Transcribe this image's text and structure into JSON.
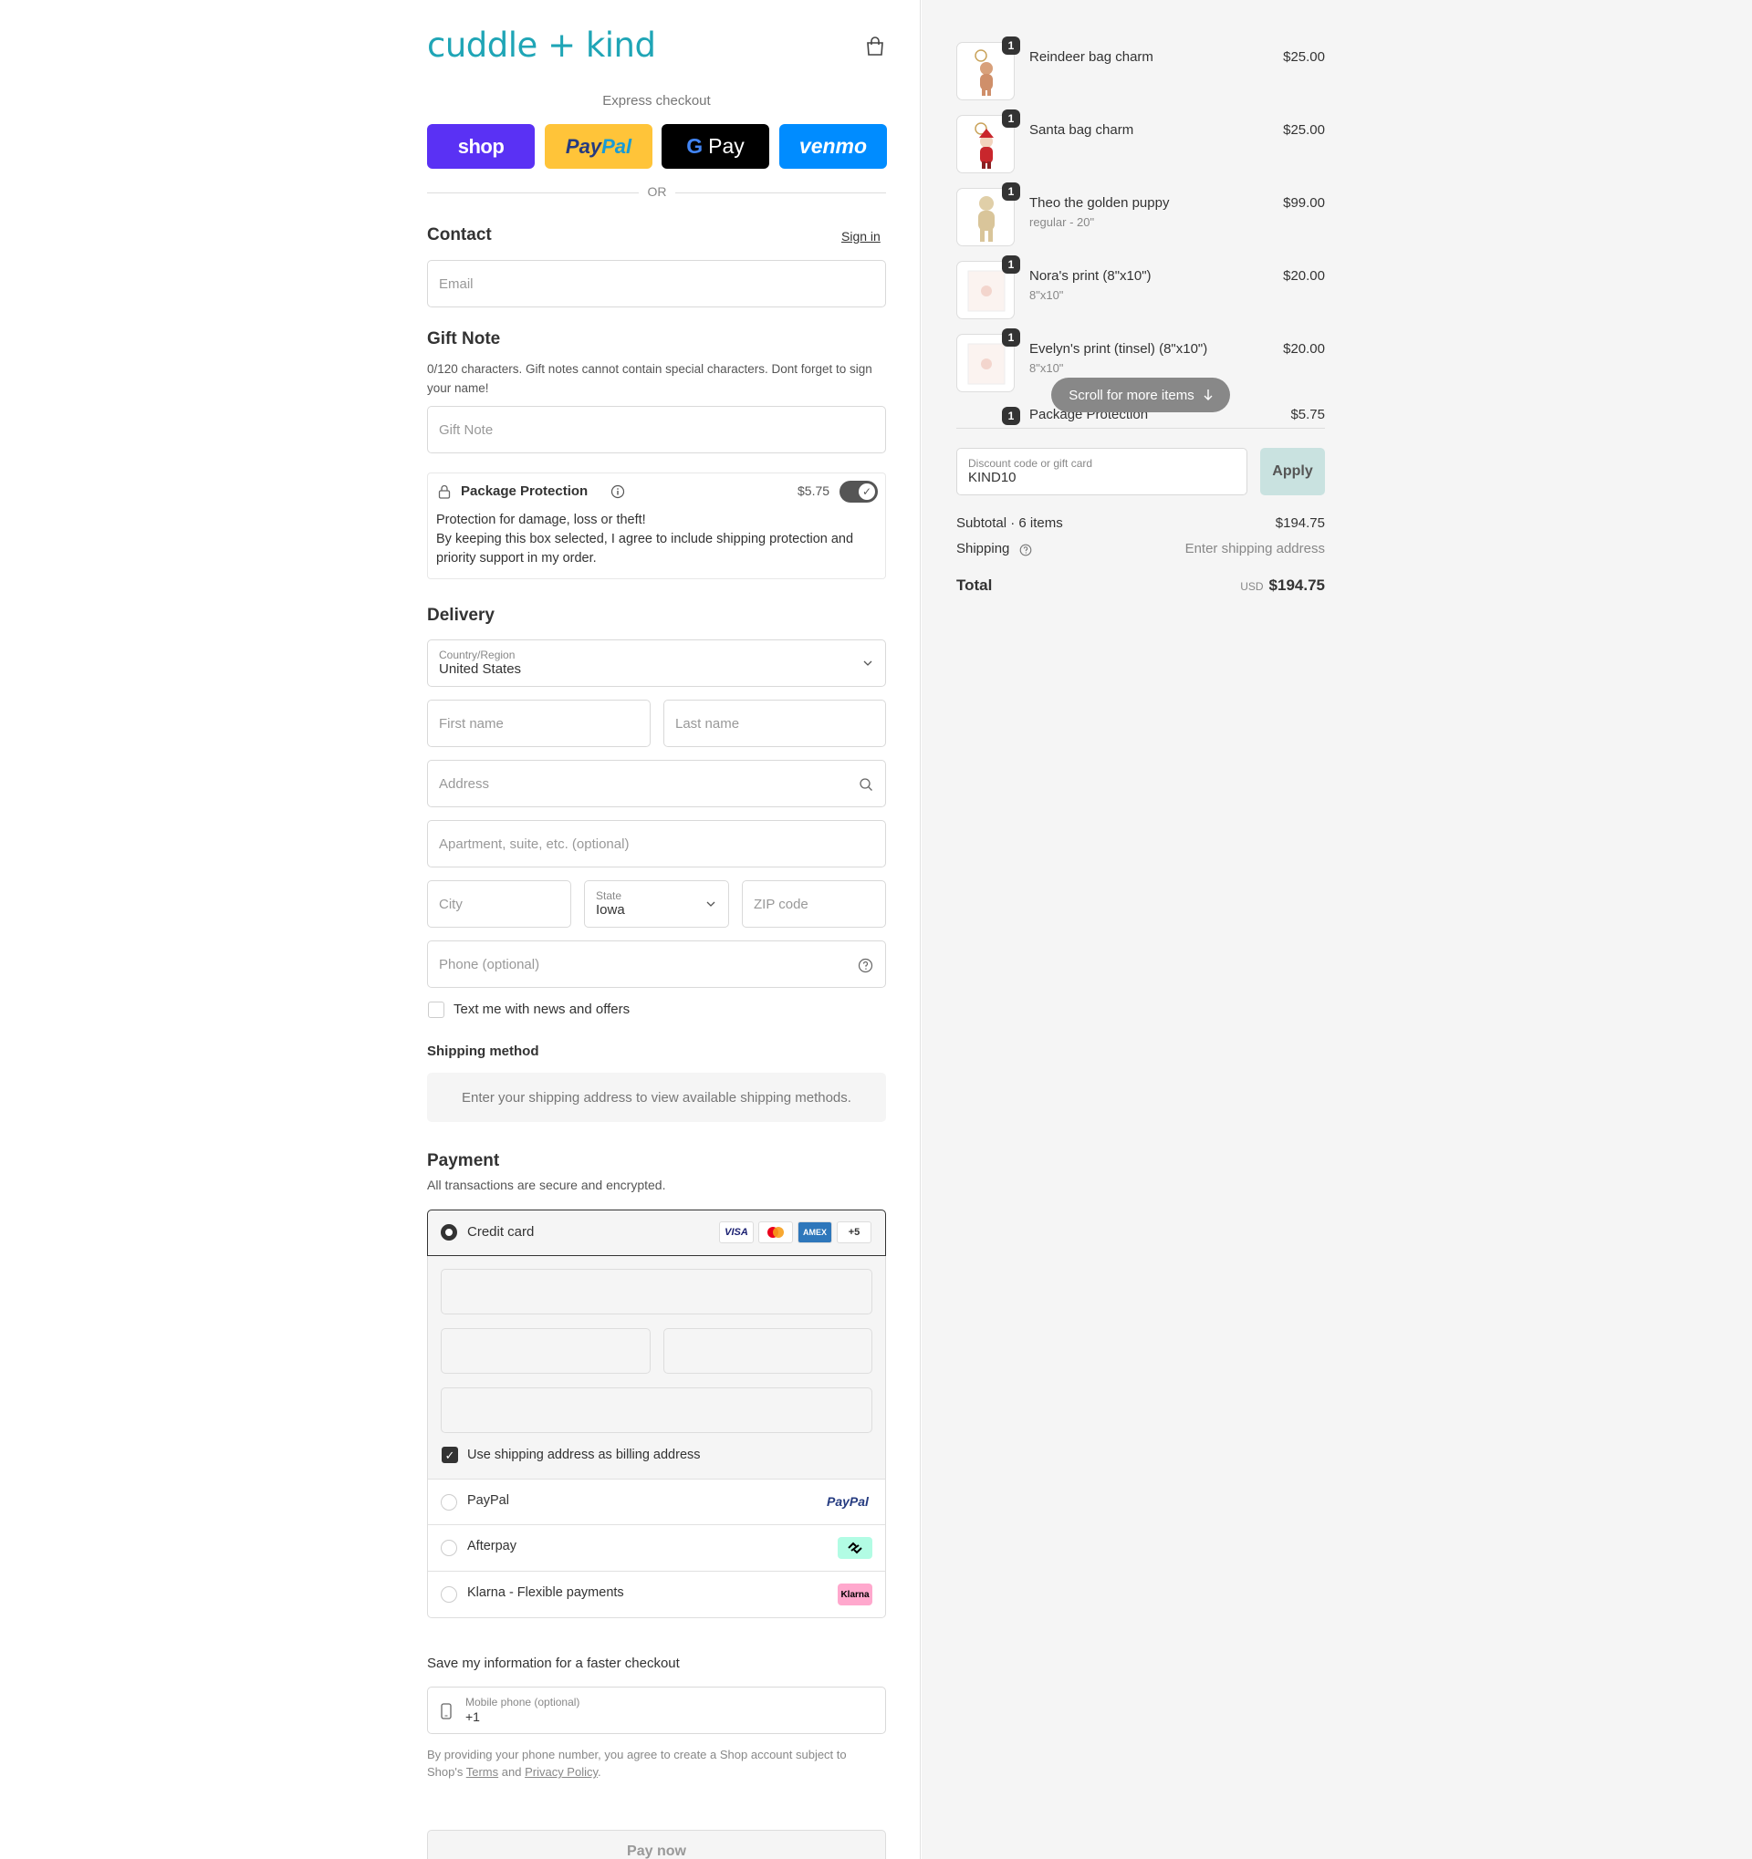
{
  "brand": {
    "logo": "cuddle + kind",
    "accent": "#1fa5b6"
  },
  "express": {
    "label": "Express checkout",
    "buttons": [
      "shop",
      "PayPal",
      "G Pay",
      "venmo"
    ],
    "or": "OR"
  },
  "contact": {
    "title": "Contact",
    "sign_in": "Sign in",
    "email_placeholder": "Email"
  },
  "gift_note": {
    "title": "Gift Note",
    "help": "0/120 characters. Gift notes cannot contain special characters. Dont forget to sign your name!",
    "placeholder": "Gift Note"
  },
  "package_protection": {
    "title": "Package Protection",
    "price": "$5.75",
    "enabled": true,
    "line1": "Protection for damage, loss or theft!",
    "line2": "By keeping this box selected, I agree to include shipping protection and priority support in my order."
  },
  "delivery": {
    "title": "Delivery",
    "country_label": "Country/Region",
    "country_value": "United States",
    "first_name": "First name",
    "last_name": "Last name",
    "address": "Address",
    "apartment": "Apartment, suite, etc. (optional)",
    "city": "City",
    "state_label": "State",
    "state_value": "Iowa",
    "zip": "ZIP code",
    "phone": "Phone (optional)",
    "text_me": "Text me with news and offers"
  },
  "shipping_method": {
    "title": "Shipping method",
    "note": "Enter your shipping address to view available shipping methods."
  },
  "payment": {
    "title": "Payment",
    "subtitle": "All transactions are secure and encrypted.",
    "credit_card": "Credit card",
    "cards": [
      "VISA",
      "MC",
      "AMEX",
      "+5"
    ],
    "billing_same": "Use shipping address as billing address",
    "paypal": "PayPal",
    "paypal_logo": "PayPal",
    "afterpay": "Afterpay",
    "klarna": "Klarna - Flexible payments",
    "klarna_logo": "Klarna"
  },
  "save_info": {
    "title": "Save my information for a faster checkout",
    "phone_label": "Mobile phone (optional)",
    "phone_prefix": "+1",
    "legal_1": "By providing your phone number, you agree to create a Shop account subject to Shop's",
    "terms": "Terms",
    "and": "and",
    "privacy": "Privacy Policy",
    "period": "."
  },
  "pay_now": "Pay now",
  "order": {
    "items": [
      {
        "name": "Reindeer bag charm",
        "variant": "",
        "price": "$25.00",
        "qty": "1"
      },
      {
        "name": "Santa bag charm",
        "variant": "",
        "price": "$25.00",
        "qty": "1"
      },
      {
        "name": "Theo the golden puppy",
        "variant": "regular - 20\"",
        "price": "$99.00",
        "qty": "1"
      },
      {
        "name": "Nora's print (8\"x10\")",
        "variant": "8\"x10\"",
        "price": "$20.00",
        "qty": "1"
      },
      {
        "name": "Evelyn's print (tinsel) (8\"x10\")",
        "variant": "8\"x10\"",
        "price": "$20.00",
        "qty": "1"
      },
      {
        "name": "Package Protection",
        "variant": "",
        "price": "$5.75",
        "qty": "1"
      }
    ],
    "scroll_hint": "Scroll for more items",
    "discount_label": "Discount code or gift card",
    "discount_value": "KIND10",
    "apply": "Apply",
    "subtotal_label": "Subtotal · 6 items",
    "subtotal": "$194.75",
    "shipping_label": "Shipping",
    "shipping_value": "Enter shipping address",
    "total_label": "Total",
    "currency": "USD",
    "total": "$194.75"
  }
}
